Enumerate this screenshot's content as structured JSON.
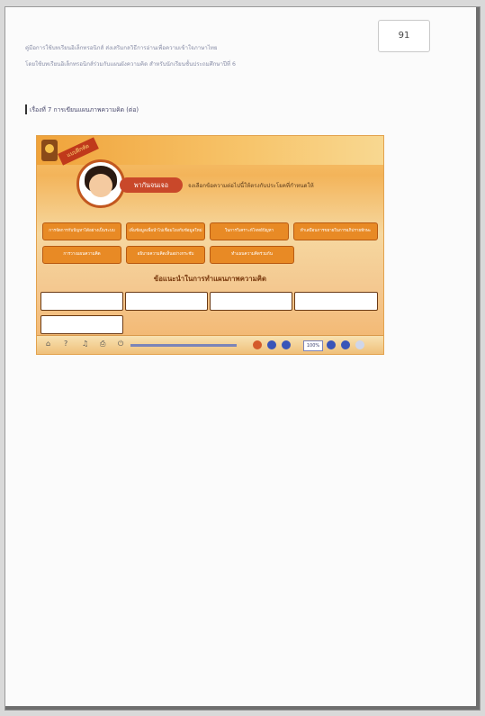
{
  "page": {
    "number": "91",
    "header_line1": "คู่มือการใช้บทเรียนอิเล็กทรอนิกส์  ส่งเสริมกลวิธีการอ่านเพื่อความเข้าใจภาษาไทย",
    "header_line2": "โดยใช้บทเรียนอิเล็กทรอนิกส์ร่วมกับแผนผังความคิด  สำหรับนักเรียนชั้นประถมศึกษาปีที่ 6",
    "section_title": "เรื่องที่ 7 การเขียนแผนภาพความคิด (ต่อ)"
  },
  "screenshot": {
    "ribbon": "แบบฝึกหัด",
    "title": "พากันจนเจอ",
    "instruction": "จงเลือกข้อความต่อไปนี้ให้ตรงกับประโยคที่กำหนดให้",
    "buttons": [
      "การจัดการกับปัญหาได้อย่างเป็นระบบ",
      "เพิ่มข้อมูลเพื่อนำไปเชื่อมโยงกับข้อมูลใหม่",
      "ในการวิเคราะห์โจทย์ปัญหา",
      "ทำเสมือนการขยายในการอภิปรายทักษะ",
      "การวางแผนความคิด",
      "อธิบายความคิดเห็นอย่างกระชับ",
      "ทำแผนความคิดร่วมกัน"
    ],
    "guide_title": "ข้อแนะนำในการทำแผนภาพความคิด",
    "zoom": "100%",
    "controls": [
      "⌂",
      "?",
      "♫",
      "⎙",
      "⏻"
    ]
  },
  "colors": {
    "accent": "#e88a25",
    "brand_red": "#c9482a"
  }
}
